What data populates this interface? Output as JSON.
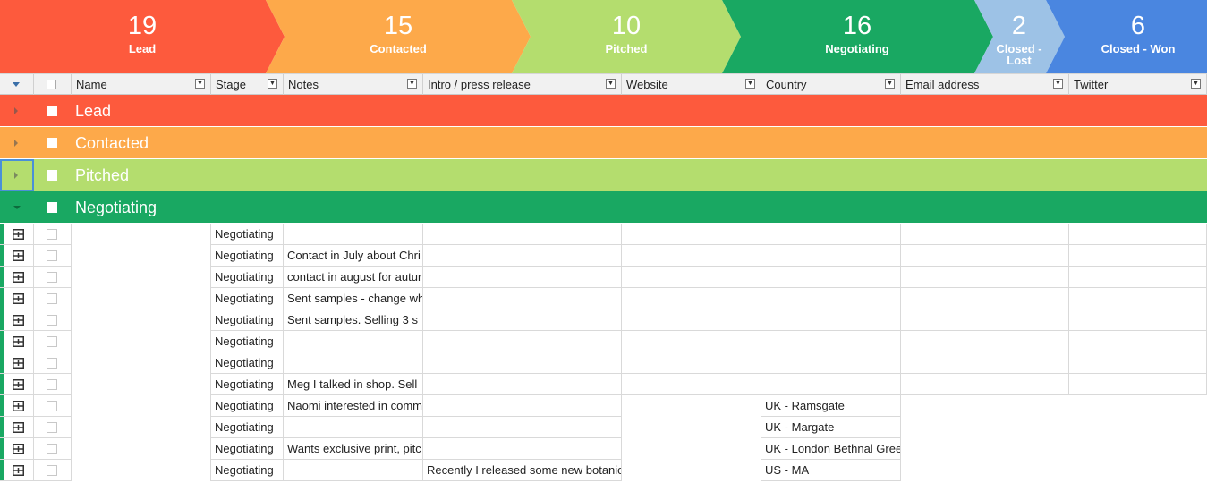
{
  "funnel": {
    "stages": [
      {
        "count": "19",
        "label": "Lead",
        "color": "#fd5a3d"
      },
      {
        "count": "15",
        "label": "Contacted",
        "color": "#fda94a"
      },
      {
        "count": "10",
        "label": "Pitched",
        "color": "#b4dd6e"
      },
      {
        "count": "16",
        "label": "Negotiating",
        "color": "#19a862"
      },
      {
        "count": "2",
        "label": "Closed - Lost",
        "color": "#9dc2e6"
      },
      {
        "count": "6",
        "label": "Closed - Won",
        "color": "#4a86e0"
      }
    ]
  },
  "columns": [
    "Name",
    "Stage",
    "Notes",
    "Intro / press release",
    "Website",
    "Country",
    "Email address",
    "Twitter"
  ],
  "groups": [
    {
      "name": "Lead",
      "color": "#fd5a3d",
      "expanded": false
    },
    {
      "name": "Contacted",
      "color": "#fda94a",
      "expanded": false
    },
    {
      "name": "Pitched",
      "color": "#b4dd6e",
      "expanded": false
    },
    {
      "name": "Negotiating",
      "color": "#19a862",
      "expanded": true
    }
  ],
  "rows": [
    {
      "stage": "Negotiating",
      "notes": "",
      "intro": "",
      "country": ""
    },
    {
      "stage": "Negotiating",
      "notes": "Contact in July about Chri",
      "intro": "",
      "country": ""
    },
    {
      "stage": "Negotiating",
      "notes": "contact in august for autur",
      "intro": "",
      "country": ""
    },
    {
      "stage": "Negotiating",
      "notes": "Sent samples - change wh",
      "intro": "",
      "country": ""
    },
    {
      "stage": "Negotiating",
      "notes": "Sent samples. Selling 3 s",
      "intro": "",
      "country": ""
    },
    {
      "stage": "Negotiating",
      "notes": "",
      "intro": "",
      "country": ""
    },
    {
      "stage": "Negotiating",
      "notes": "",
      "intro": "",
      "country": ""
    },
    {
      "stage": "Negotiating",
      "notes": "Meg I talked in shop. Sell",
      "intro": "",
      "country": ""
    },
    {
      "stage": "Negotiating",
      "notes": "Naomi interested in comm",
      "intro": "",
      "country": "UK - Ramsgate"
    },
    {
      "stage": "Negotiating",
      "notes": "",
      "intro": "",
      "country": "UK - Margate"
    },
    {
      "stage": "Negotiating",
      "notes": "Wants exclusive print, pitc",
      "intro": "",
      "country": "UK - London Bethnal Gree"
    },
    {
      "stage": "Negotiating",
      "notes": "",
      "intro": "Recently I released some new botanic",
      "country": "US - MA"
    }
  ],
  "icons": {
    "row_expand": "expand-record-icon",
    "column_menu": "column-dropdown-icon"
  }
}
